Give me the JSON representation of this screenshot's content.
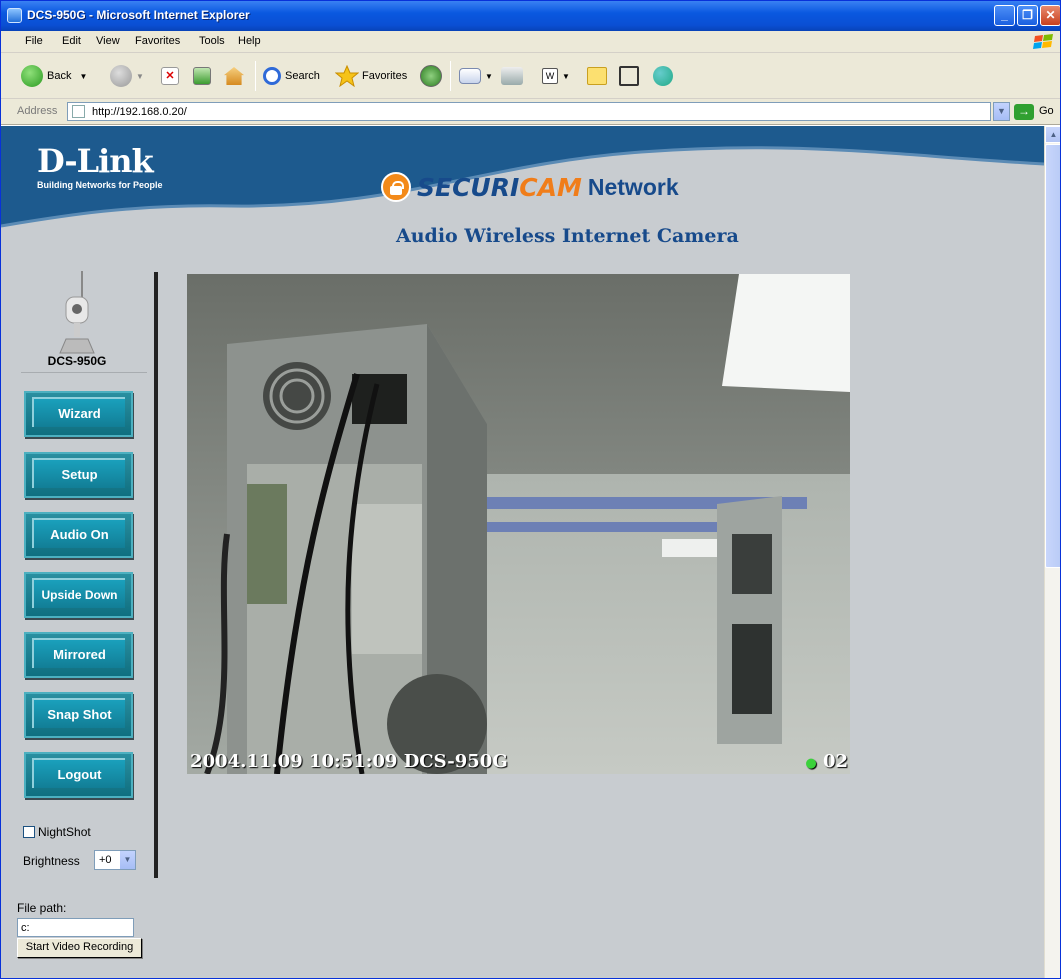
{
  "window": {
    "title": "DCS-950G - Microsoft Internet Explorer"
  },
  "menu": [
    "File",
    "Edit",
    "View",
    "Favorites",
    "Tools",
    "Help"
  ],
  "toolbar": {
    "back": "Back",
    "search": "Search",
    "favorites": "Favorites"
  },
  "address": {
    "label": "Address",
    "url": "http://192.168.0.20/",
    "go": "Go"
  },
  "header": {
    "brand": "D-Link",
    "tagline": "Building Networks for People",
    "product_a": "SECURI",
    "product_b": "CAM",
    "product_c": "Network",
    "subtitle": "Audio Wireless Internet Camera"
  },
  "sidebar": {
    "model": "DCS-950G",
    "buttons": [
      "Wizard",
      "Setup",
      "Audio On",
      "Upside Down",
      "Mirrored",
      "Snap Shot",
      "Logout"
    ],
    "nightshot": "NightShot",
    "brightness_label": "Brightness",
    "brightness_value": "+0",
    "filepath_label": "File path:",
    "filepath_value": "c:",
    "record_button": "Start Video Recording"
  },
  "video": {
    "timestamp": "2004.11.09 10:51:09 DCS-950G",
    "count": "02"
  }
}
